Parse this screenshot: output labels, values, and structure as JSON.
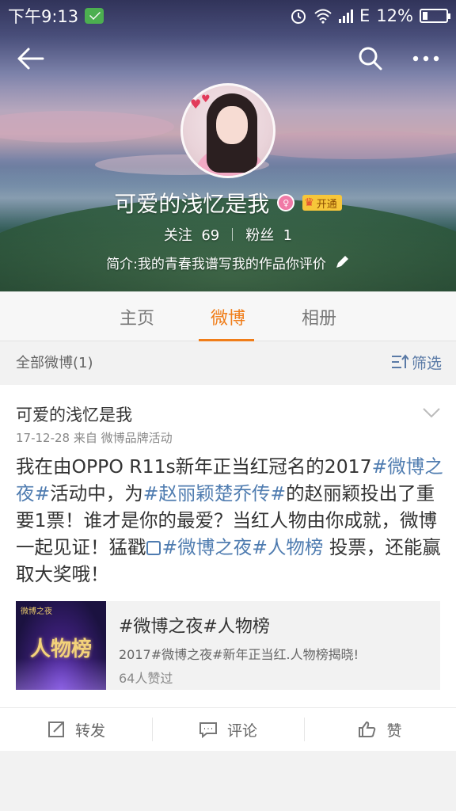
{
  "status_bar": {
    "time": "下午9:13",
    "network": "E",
    "battery": "12%"
  },
  "profile": {
    "name": "可爱的浅忆是我",
    "vip_label": "开通",
    "following_label": "关注",
    "following_count": "69",
    "followers_label": "粉丝",
    "followers_count": "1",
    "bio": "简介:我的青春我谱写我的作品你评价"
  },
  "tabs": [
    {
      "label": "主页",
      "active": false
    },
    {
      "label": "微博",
      "active": true
    },
    {
      "label": "相册",
      "active": false
    }
  ],
  "filter": {
    "all_label": "全部微博(1)",
    "filter_label": "筛选"
  },
  "post": {
    "author": "可爱的浅忆是我",
    "meta": "17-12-28  来自 微博品牌活动",
    "body": {
      "p1": "我在由OPPO R11s新年正当红冠名的2017",
      "tag1": "#微博之夜#",
      "p2": "活动中，为",
      "tag2": "#赵丽颖楚乔传#",
      "p3": "的赵丽颖投出了重要1票！谁才是你的最爱？当红人物由你成就，微博一起见证！猛戳",
      "tag3": "#微博之夜#人物榜",
      "p4": " 投票，还能赢取大奖哦！"
    },
    "share": {
      "thumb_logo": "微博之夜",
      "thumb_text": "人物榜",
      "title": "#微博之夜#人物榜",
      "desc": "2017#微博之夜#新年正当红.人物榜揭晓!",
      "likes": "64人赞过"
    },
    "actions": {
      "repost": "转发",
      "comment": "评论",
      "like": "赞"
    }
  },
  "colors": {
    "accent": "#f07d19",
    "link": "#4f7cb0"
  }
}
